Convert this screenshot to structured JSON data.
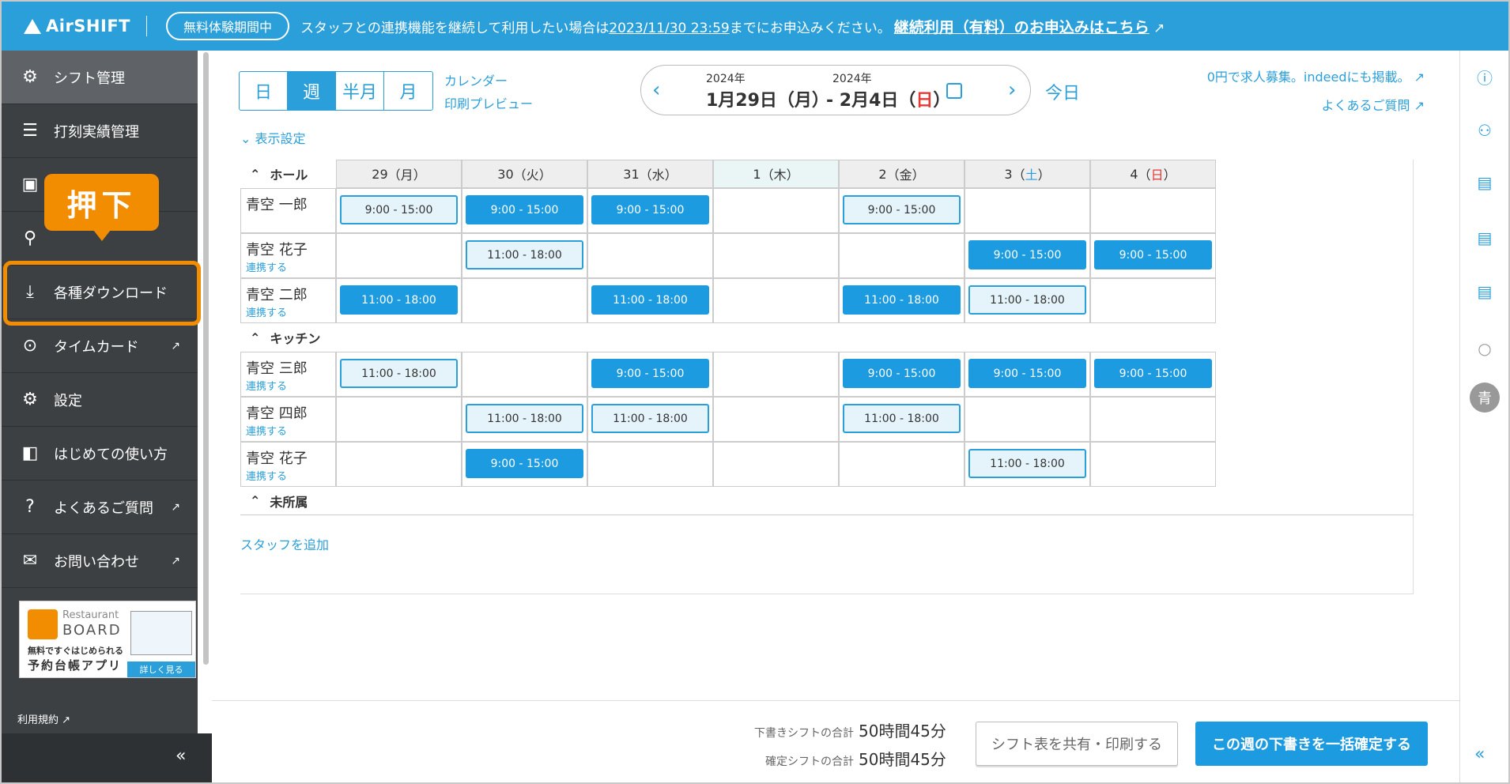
{
  "topbar": {
    "logo": "AirSHIFT",
    "trial_badge": "無料体験期間中",
    "notice_pre": "スタッフとの連携機能を継続して利用したい場合は",
    "notice_date": "2023/11/30 23:59",
    "notice_mid": "までにお申込みください。",
    "notice_link": "継続利用（有料）のお申込みはこちら"
  },
  "sidebar": {
    "items": [
      {
        "label": "シフト管理",
        "icon": "gear-people-icon"
      },
      {
        "label": "打刻実績管理",
        "icon": "timecard-list-icon"
      },
      {
        "label": "",
        "icon": "id-card-icon"
      },
      {
        "label": "",
        "icon": "search-person-icon"
      },
      {
        "label": "各種ダウンロード",
        "icon": "download-icon"
      },
      {
        "label": "タイムカード",
        "icon": "lock-clock-icon"
      },
      {
        "label": "設定",
        "icon": "gear-icon"
      },
      {
        "label": "はじめての使い方",
        "icon": "guide-icon"
      },
      {
        "label": "よくあるご質問",
        "icon": "question-icon"
      },
      {
        "label": "お問い合わせ",
        "icon": "mail-icon"
      }
    ],
    "tooltip": "押下",
    "banner": {
      "line1": "Restaurant",
      "line2": "BOARD",
      "line3": "無料ですぐはじめられる",
      "line4": "予約台帳アプリ",
      "button": "詳しく見る"
    },
    "terms": "利用規約"
  },
  "toolbar": {
    "views": [
      "日",
      "週",
      "半月",
      "月"
    ],
    "selected": "週",
    "calendar_link": "カレンダー",
    "print_link": "印刷プレビュー",
    "year_start": "2024年",
    "date_start": "1月29日（月）",
    "year_end": "2024年",
    "date_end_pre": "- 2月4日（",
    "date_end_day": "日",
    "date_end_post": "）",
    "today": "今日",
    "ad_link": "0円で求人募集。indeedにも掲載。",
    "faq_link": "よくあるご質問",
    "display_settings": "表示設定"
  },
  "grid": {
    "days": [
      {
        "num": "29",
        "dow": "月",
        "kind": "normal"
      },
      {
        "num": "30",
        "dow": "火",
        "kind": "normal"
      },
      {
        "num": "31",
        "dow": "水",
        "kind": "normal"
      },
      {
        "num": "1",
        "dow": "木",
        "kind": "today"
      },
      {
        "num": "2",
        "dow": "金",
        "kind": "normal"
      },
      {
        "num": "3",
        "dow": "土",
        "kind": "sat"
      },
      {
        "num": "4",
        "dow": "日",
        "kind": "sun"
      }
    ],
    "link_label": "連携する",
    "groups": [
      {
        "name": "ホール",
        "rows": [
          {
            "name": "青空 一郎",
            "link": false,
            "shifts": [
              [
                "9:00 - 15:00",
                "draft"
              ],
              [
                "9:00 - 15:00",
                "conf"
              ],
              [
                "9:00 - 15:00",
                "conf"
              ],
              null,
              [
                "9:00 - 15:00",
                "draft"
              ],
              null,
              null
            ]
          },
          {
            "name": "青空 花子",
            "link": true,
            "shifts": [
              null,
              [
                "11:00 - 18:00",
                "draft"
              ],
              null,
              null,
              null,
              [
                "9:00 - 15:00",
                "conf"
              ],
              [
                "9:00 - 15:00",
                "conf"
              ]
            ]
          },
          {
            "name": "青空 二郎",
            "link": true,
            "shifts": [
              [
                "11:00 - 18:00",
                "conf"
              ],
              null,
              [
                "11:00 - 18:00",
                "conf"
              ],
              null,
              [
                "11:00 - 18:00",
                "conf"
              ],
              [
                "11:00 - 18:00",
                "draft"
              ],
              null
            ]
          }
        ]
      },
      {
        "name": "キッチン",
        "rows": [
          {
            "name": "青空 三郎",
            "link": true,
            "shifts": [
              [
                "11:00 - 18:00",
                "draft"
              ],
              null,
              [
                "9:00 - 15:00",
                "conf"
              ],
              null,
              [
                "9:00 - 15:00",
                "conf"
              ],
              [
                "9:00 - 15:00",
                "conf"
              ],
              [
                "9:00 - 15:00",
                "conf"
              ]
            ]
          },
          {
            "name": "青空 四郎",
            "link": true,
            "shifts": [
              null,
              [
                "11:00 - 18:00",
                "draft"
              ],
              [
                "11:00 - 18:00",
                "draft"
              ],
              null,
              [
                "11:00 - 18:00",
                "draft"
              ],
              null,
              null
            ]
          },
          {
            "name": "青空 花子",
            "link": true,
            "shifts": [
              null,
              [
                "9:00 - 15:00",
                "conf"
              ],
              null,
              null,
              null,
              [
                "11:00 - 18:00",
                "draft"
              ],
              null
            ]
          }
        ]
      },
      {
        "name": "未所属",
        "rows": []
      }
    ],
    "add_staff": "スタッフを追加"
  },
  "footer": {
    "draft_label": "下書きシフトの合計",
    "draft_value": "50時間45分",
    "confirmed_label": "確定シフトの合計",
    "confirmed_value": "50時間45分",
    "share_button": "シフト表を共有・印刷する",
    "confirm_button": "この週の下書きを一括確定する"
  },
  "rail": {
    "avatar": "青"
  },
  "colors": {
    "accent": "#2b9fd9",
    "confirmed": "#1d9be0",
    "highlight": "#f28c00",
    "sidebar": "#3c4043"
  }
}
